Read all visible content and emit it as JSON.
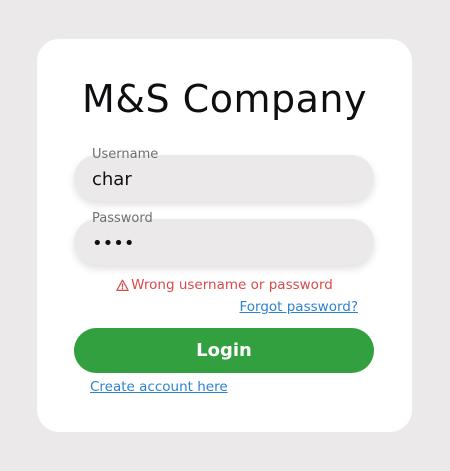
{
  "app": {
    "title": "M&S Company"
  },
  "form": {
    "username": {
      "label": "Username",
      "value": "char"
    },
    "password": {
      "label": "Password",
      "value": "••••"
    },
    "error_message": "Wrong username or password",
    "forgot_link": "Forgot password?",
    "login_button": "Login",
    "create_link": "Create account here"
  },
  "icons": {
    "error": "warning-triangle-icon"
  },
  "colors": {
    "background": "#ebe9ea",
    "card": "#ffffff",
    "primary_button": "#33a040",
    "error": "#d84a4a",
    "link": "#2e82d2"
  }
}
